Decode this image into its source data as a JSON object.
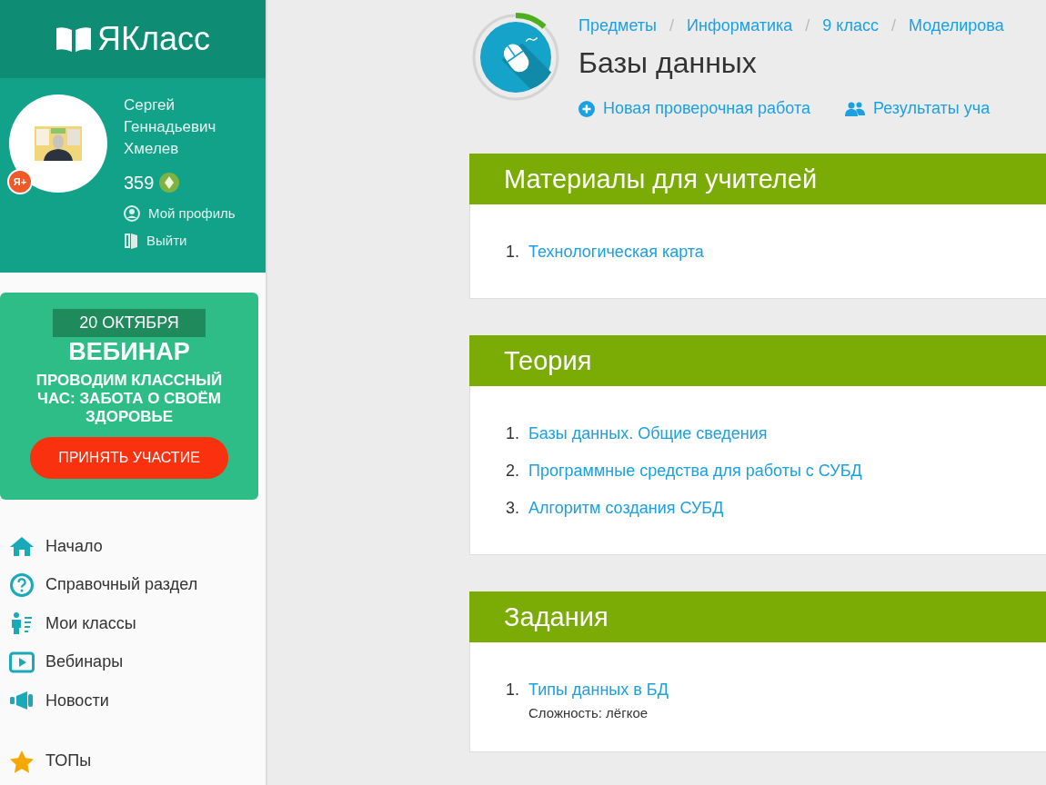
{
  "logo": {
    "text": "ЯКласс"
  },
  "user": {
    "name": "Сергей Геннадьевич Хмелев",
    "points": "359",
    "badge": "Я+",
    "links": [
      {
        "label": "Мой профиль"
      },
      {
        "label": "Выйти"
      }
    ]
  },
  "banner": {
    "date": "20 ОКТЯБРЯ",
    "title": "ВЕБИНАР",
    "subtitle": "ПРОВОДИМ КЛАССНЫЙ ЧАС: ЗАБОТА О СВОЁМ ЗДОРОВЬЕ",
    "button": "ПРИНЯТЬ УЧАСТИЕ"
  },
  "nav_groups": [
    [
      {
        "label": "Начало"
      },
      {
        "label": "Справочный раздел"
      },
      {
        "label": "Мои классы"
      },
      {
        "label": "Вебинары"
      },
      {
        "label": "Новости"
      }
    ],
    [
      {
        "label": "ТОПы"
      }
    ]
  ],
  "header": {
    "level": 0.12,
    "breadcrumbs": [
      {
        "label": "Предметы",
        "separator": "/"
      },
      {
        "label": "Информатика",
        "separator": "/"
      },
      {
        "label": "9 класс",
        "separator": "/"
      },
      {
        "label": "Моделирова"
      }
    ],
    "title": "Базы данных",
    "actions": [
      {
        "label": "Новая проверочная работа"
      },
      {
        "label": "Результаты уча"
      }
    ]
  },
  "sections": [
    {
      "heading": "Материалы для учителей",
      "items": [
        {
          "number": "1.",
          "label": "Технологическая карта"
        }
      ]
    },
    {
      "heading": "Теория",
      "items": [
        {
          "number": "1.",
          "label": "Базы данных. Общие сведения"
        },
        {
          "number": "2.",
          "label": "Программные средства для работы с СУБД"
        },
        {
          "number": "3.",
          "label": "Алгоритм создания СУБД"
        }
      ]
    },
    {
      "heading": "Задания",
      "items": [
        {
          "number": "1.",
          "label": "Типы данных в БД",
          "difficulty": "Сложность: лёгкое"
        }
      ]
    }
  ]
}
